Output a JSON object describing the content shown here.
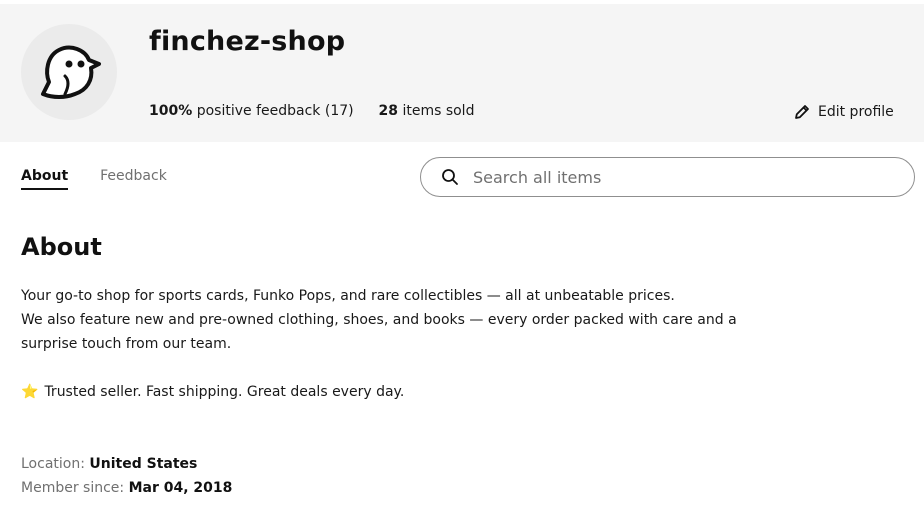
{
  "profile": {
    "shop_name": "finchez-shop",
    "positive_pct": "100%",
    "positive_label": "positive feedback",
    "feedback_count": "(17)",
    "items_sold_num": "28",
    "items_sold_label": "items sold",
    "edit_label": "Edit profile",
    "avatar_icon": "bird-icon"
  },
  "tabs": [
    {
      "label": "About",
      "active": true
    },
    {
      "label": "Feedback",
      "active": false
    }
  ],
  "search": {
    "placeholder": "Search all items",
    "value": ""
  },
  "about": {
    "title": "About",
    "lines": [
      "Your go-to shop for sports cards, Funko Pops, and rare collectibles — all at unbeatable prices.",
      "We also feature new and pre-owned clothing, shoes, and books — every order packed with care and a surprise touch from our team."
    ],
    "tagline_icon": "⭐",
    "tagline": "Trusted seller. Fast shipping. Great deals every day.",
    "location_label": "Location:",
    "location_value": "United States",
    "member_label": "Member since:",
    "member_value": "Mar 04, 2018"
  },
  "colors": {
    "header_bg": "#f5f5f5",
    "accent_text": "#191919",
    "muted_text": "#707070"
  }
}
